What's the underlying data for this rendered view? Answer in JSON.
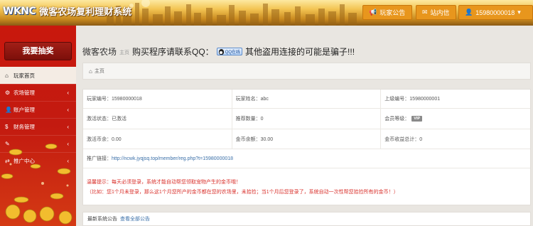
{
  "header": {
    "logo": "WKNC",
    "site_title": "微客农场复利理财系统",
    "notice_btn": "玩家公告",
    "mail_btn": "站内信",
    "user_btn": "15980000018"
  },
  "sidebar": {
    "lottery_btn": "我要抽奖",
    "items": [
      {
        "label": "玩家首页",
        "icon": "home-icon"
      },
      {
        "label": "农场管理",
        "icon": "gear-icon"
      },
      {
        "label": "账户管理",
        "icon": "user-icon"
      },
      {
        "label": "财务管理",
        "icon": "dollar-icon"
      },
      {
        "label": "",
        "icon": "chat-icon"
      },
      {
        "label": "推广中心",
        "icon": "share-icon"
      }
    ]
  },
  "page": {
    "app_name": "微客农场",
    "sub": "主页",
    "heading_prefix": "购买程序请联系QQ：",
    "qq_badge": "QQ在线",
    "heading_suffix": "其他盗用连接的可能是骗子!!!"
  },
  "breadcrumb": {
    "label": "主页"
  },
  "info": {
    "player_id": "玩家编号：15980000018",
    "player_name": "玩家姓名：abc",
    "upline_id": "上级编号：15980000001",
    "activation": "激活状态：已激活",
    "referral_count": "推荐数量：0",
    "member_level": "会员等级：",
    "vip_badge": "VIP",
    "activation_coins": "激活币余：0.00",
    "gold_balance": "金币余额：30.00",
    "gold_income": "金币收益总计：0",
    "promo_label": "推广链接：",
    "promo_url": "http://ncwk.jyqjsq.top/member/reg.php?t=15980000018",
    "notice_1": "温馨提示：每天必须登录，系统才能自动帮您领取宠物产生的金币哦！",
    "notice_2": "（比如：您1个月未登录，那么这1个月您所产的金币都在您的农场里，未拾捡；当1个月后您登录了，系统自动一次性帮您拾捡所有的金币！）"
  },
  "latest": {
    "title": "最新系统公告",
    "link": "查看全部公告"
  },
  "colors": {
    "sidebar_red": "#c9180d",
    "header_orange": "#e8961d",
    "notice_red": "#d9302b",
    "link_blue": "#3a6fa8"
  }
}
